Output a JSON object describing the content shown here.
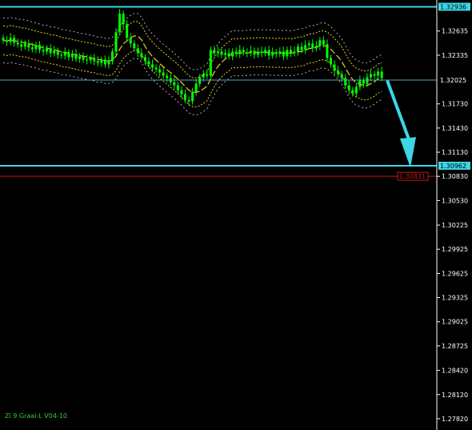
{
  "chart_data": {
    "type": "candlestick",
    "background": "#000000",
    "colors": {
      "candle": "#00ff00",
      "level_line": "#3cd6e6",
      "target_line": "#c81414",
      "mid_line": "#5aa0c8",
      "band": "#e6d21e",
      "env": "#d2d2d2",
      "arrow": "#3cd6e6",
      "axis": "#ffffff",
      "indicator": "#33cc33"
    },
    "y_range": [
      1.2768,
      1.3302
    ],
    "y_ticks": [
      "1.32635",
      "1.32335",
      "1.31730",
      "1.31430",
      "1.31130",
      "1.30830",
      "1.30530",
      "1.30225",
      "1.29925",
      "1.29625",
      "1.29325",
      "1.29025",
      "1.28725",
      "1.28420",
      "1.28120",
      "1.27820"
    ],
    "levels": [
      {
        "name": "upper-level",
        "value": "1.32936",
        "style": "level"
      },
      {
        "name": "mid-level",
        "value": "1.32025",
        "style": "mid"
      },
      {
        "name": "lower-level",
        "value": "1.30962",
        "style": "level"
      },
      {
        "name": "target-level",
        "value": "1.30831",
        "style": "target"
      }
    ],
    "candles_close": [
      1.3252,
      1.325,
      1.3255,
      1.3249,
      1.3247,
      1.3244,
      1.3248,
      1.3243,
      1.3241,
      1.3246,
      1.324,
      1.3238,
      1.3242,
      1.3236,
      1.3239,
      1.3234,
      1.3233,
      1.3237,
      1.3231,
      1.3235,
      1.3229,
      1.3232,
      1.3228,
      1.3227,
      1.323,
      1.3226,
      1.3224,
      1.3228,
      1.3222,
      1.3226,
      1.3238,
      1.3262,
      1.3285,
      1.3272,
      1.3255,
      1.3248,
      1.3242,
      1.3236,
      1.3231,
      1.3226,
      1.3222,
      1.3218,
      1.3216,
      1.3212,
      1.3208,
      1.3205,
      1.32,
      1.3196,
      1.319,
      1.3185,
      1.3178,
      1.3176,
      1.3188,
      1.3198,
      1.3206,
      1.321,
      1.3208,
      1.324,
      1.3236,
      1.3238,
      1.3234,
      1.3236,
      1.3232,
      1.3238,
      1.3235,
      1.324,
      1.3237,
      1.3236,
      1.3239,
      1.3234,
      1.3238,
      1.3236,
      1.324,
      1.3233,
      1.3237,
      1.3235,
      1.3238,
      1.3232,
      1.324,
      1.3236,
      1.3238,
      1.3244,
      1.324,
      1.3246,
      1.3248,
      1.3242,
      1.3245,
      1.3252,
      1.3247,
      1.323,
      1.3222,
      1.3214,
      1.321,
      1.3205,
      1.3196,
      1.319,
      1.3186,
      1.3194,
      1.3202,
      1.3198,
      1.3206,
      1.321,
      1.3208,
      1.3213,
      1.3205
    ],
    "arrow": {
      "from": [
        484,
        1.3202
      ],
      "to": [
        513,
        1.3094
      ]
    }
  },
  "indicator_label": "Zi 9 Graal-L V04-10",
  "footer_label": "Zi 9 Graal-L V04-10"
}
